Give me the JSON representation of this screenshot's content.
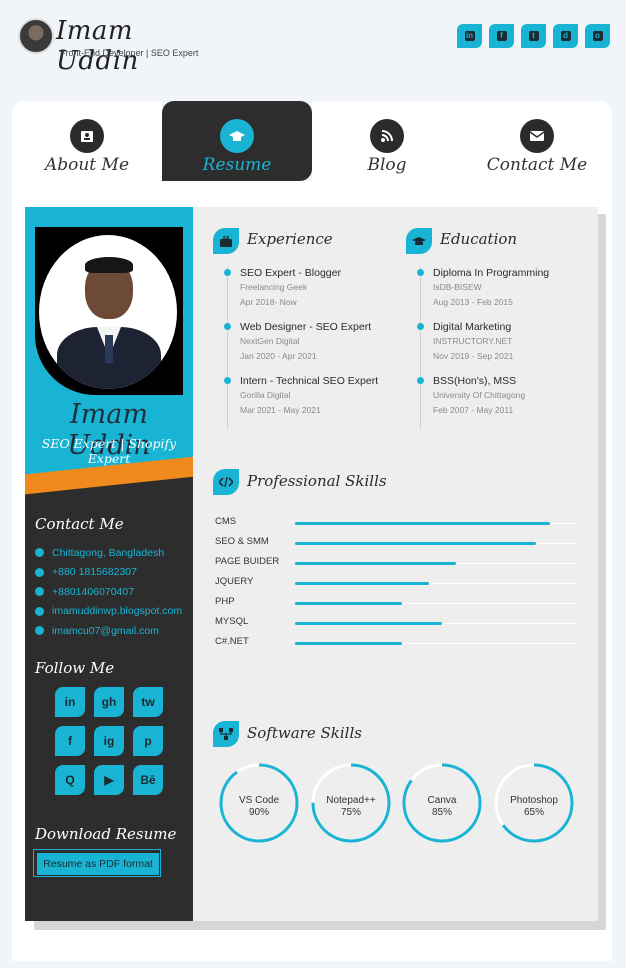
{
  "header": {
    "logo_name": "Imam Uddin",
    "logo_tagline": "Front-End Developer | SEO Expert",
    "social": [
      {
        "name": "linkedin-icon",
        "glyph": "in"
      },
      {
        "name": "facebook-icon",
        "glyph": "f"
      },
      {
        "name": "twitter-icon",
        "glyph": "t"
      },
      {
        "name": "discord-icon",
        "glyph": "d"
      },
      {
        "name": "instagram-icon",
        "glyph": "o"
      }
    ]
  },
  "tabs": [
    {
      "label": "About Me",
      "icon": "id-card-icon",
      "active": false
    },
    {
      "label": "Resume",
      "icon": "graduation-cap-icon",
      "active": true
    },
    {
      "label": "Blog",
      "icon": "blog-icon",
      "active": false
    },
    {
      "label": "Contact Me",
      "icon": "envelope-icon",
      "active": false
    }
  ],
  "profile": {
    "name": "Imam Uddin",
    "title": "SEO Expert | Shopify Expert"
  },
  "contact": {
    "heading": "Contact Me",
    "items": [
      {
        "icon": "location-icon",
        "text": "Chittagong, Bangladesh"
      },
      {
        "icon": "phone-icon",
        "text": "+880 1815682307"
      },
      {
        "icon": "whatsapp-icon",
        "text": "+8801406070407"
      },
      {
        "icon": "globe-icon",
        "text": "imamuddinwp.blogspot.com"
      },
      {
        "icon": "email-icon",
        "text": "imamcu07@gmail.com"
      }
    ]
  },
  "follow": {
    "heading": "Follow Me",
    "items": [
      {
        "icon": "linkedin-icon",
        "glyph": "in"
      },
      {
        "icon": "github-icon",
        "glyph": "gh"
      },
      {
        "icon": "twitter-icon",
        "glyph": "tw"
      },
      {
        "icon": "facebook-icon",
        "glyph": "f"
      },
      {
        "icon": "instagram-icon",
        "glyph": "ig"
      },
      {
        "icon": "pinterest-icon",
        "glyph": "p"
      },
      {
        "icon": "quora-icon",
        "glyph": "Q"
      },
      {
        "icon": "youtube-icon",
        "glyph": "▶"
      },
      {
        "icon": "behance-icon",
        "glyph": "Bē"
      }
    ]
  },
  "download": {
    "heading": "Download Resume",
    "button_label": "Resume as PDF format"
  },
  "experience": {
    "heading": "Experience",
    "items": [
      {
        "title": "SEO Expert - Blogger",
        "org": "Freelancing Geek",
        "dates": "Apr 2018- Now"
      },
      {
        "title": "Web Designer - SEO Expert",
        "org": "NextGen Digital",
        "dates": "Jan 2020 - Apr 2021"
      },
      {
        "title": "Intern - Technical SEO Expert",
        "org": "Gorilla Digital",
        "dates": "Mar 2021 - May 2021"
      }
    ]
  },
  "education": {
    "heading": "Education",
    "items": [
      {
        "title": "Diploma In Programming",
        "org": "IsDB-BISEW",
        "dates": "Aug 2013 - Feb 2015"
      },
      {
        "title": "Digital Marketing",
        "org": "INSTRUCTORY.NET",
        "dates": "Nov 2019 - Sep 2021"
      },
      {
        "title": "BSS(Hon's), MSS",
        "org": "University Of Chittagong",
        "dates": "Feb 2007 - May 2011"
      }
    ]
  },
  "professional_skills": {
    "heading": "Professional Skills",
    "items": [
      {
        "name": "CMS",
        "level": 0.95
      },
      {
        "name": "SEO & SMM",
        "level": 0.9
      },
      {
        "name": "PAGE BUIDER",
        "level": 0.6
      },
      {
        "name": "JQUERY",
        "level": 0.5
      },
      {
        "name": "PHP",
        "level": 0.4
      },
      {
        "name": "MYSQL",
        "level": 0.55
      },
      {
        "name": "C#.NET",
        "level": 0.4
      }
    ]
  },
  "software_skills": {
    "heading": "Software Skills",
    "items": [
      {
        "name": "VS Code",
        "percent_label": "90%",
        "value": 90
      },
      {
        "name": "Notepad++",
        "percent_label": "75%",
        "value": 75
      },
      {
        "name": "Canva",
        "percent_label": "85%",
        "value": 85
      },
      {
        "name": "Photoshop",
        "percent_label": "65%",
        "value": 65
      }
    ]
  },
  "colors": {
    "accent": "#19b4d4",
    "dark": "#2d2d2d",
    "orange": "#f08a1c"
  }
}
